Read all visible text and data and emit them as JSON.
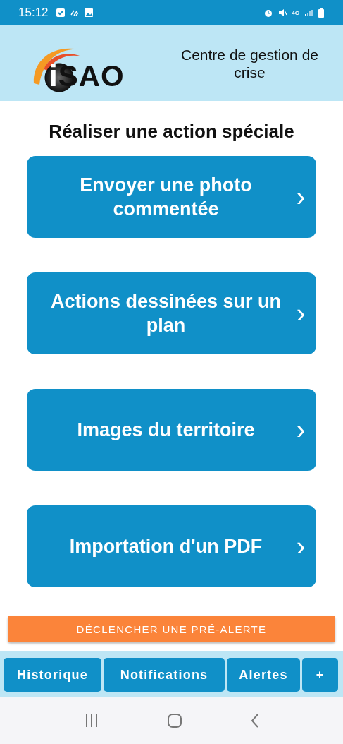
{
  "status_bar": {
    "time": "15:12",
    "network": "4G"
  },
  "header": {
    "logo": "iSAO",
    "title": "Centre de gestion de crise"
  },
  "heading": "Réaliser une action spéciale",
  "actions": [
    {
      "label": "Envoyer une photo commentée",
      "chevron": "›"
    },
    {
      "label": "Actions dessinées sur un plan",
      "chevron": "›"
    },
    {
      "label": "Images du territoire",
      "chevron": "›"
    },
    {
      "label": "Importation d'un PDF",
      "chevron": "›"
    }
  ],
  "alert_button": "DÉCLENCHER UNE PRÉ-ALERTE",
  "bottom_tabs": [
    "Historique",
    "Notifications",
    "Alertes",
    "+"
  ]
}
